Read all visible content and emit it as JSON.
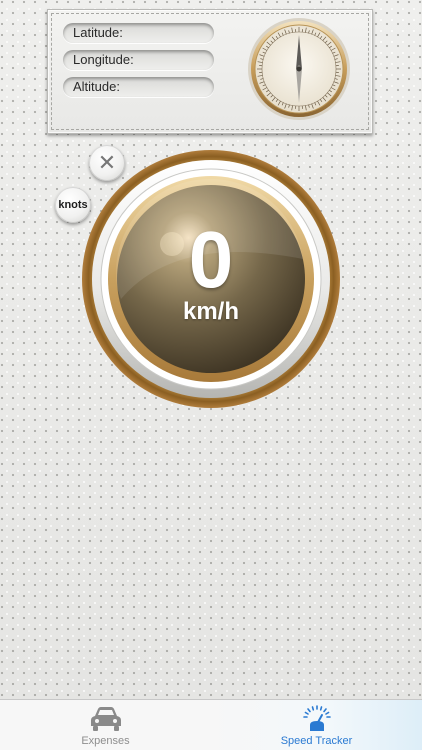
{
  "location": {
    "latitude_label": "Latitude:",
    "longitude_label": "Longitude:",
    "altitude_label": "Altitude:"
  },
  "speed": {
    "value": "0",
    "unit": "km/h",
    "alt_unit_button": "knots",
    "close_symbol": "✕"
  },
  "tab_bar": {
    "tabs": [
      {
        "label": "Expenses",
        "icon": "car-icon",
        "selected": false
      },
      {
        "label": "Speed Tracker",
        "icon": "speedometer-icon",
        "selected": true
      }
    ]
  },
  "colors": {
    "gold_ring": "#c49a55",
    "dial_center": "#6e6142",
    "selected_tab": "#2a7ad2",
    "unselected_tab": "#8e8e8e"
  }
}
